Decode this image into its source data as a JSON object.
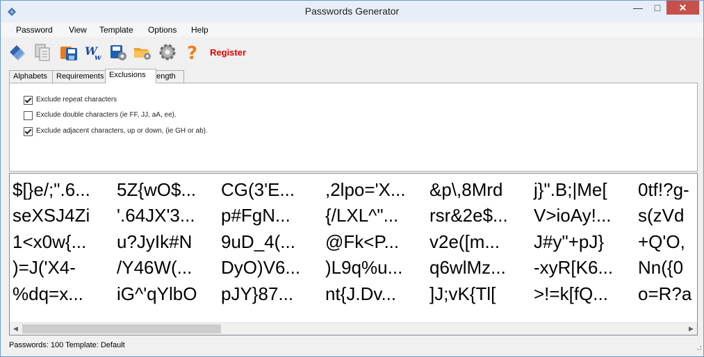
{
  "window": {
    "title": "Passwords Generator",
    "controls": [
      "—",
      "□",
      "✕"
    ]
  },
  "menu": [
    "Password",
    "View",
    "Template",
    "Options",
    "Help"
  ],
  "toolbar": {
    "icons": [
      "generate-icon",
      "copy-icon",
      "save-icon",
      "word-icon",
      "settings-save-icon",
      "folder-settings-icon",
      "gear-icon",
      "help-icon"
    ],
    "register_label": "Register"
  },
  "tabs": [
    {
      "label": "Alphabets",
      "active": false
    },
    {
      "label": "Requirements",
      "active": false
    },
    {
      "label": "Exclusions",
      "active": true
    },
    {
      "label": "Length",
      "active": false
    }
  ],
  "exclusions": [
    {
      "label": "Exclude repeat characters",
      "checked": true
    },
    {
      "label": "Exclude double characters (ie FF, JJ, aA, ee).",
      "checked": false
    },
    {
      "label": "Exclude adjacent characters, up or down, (ie GH or ab).",
      "checked": true
    }
  ],
  "passwords": [
    [
      "$[}e/;\".6...",
      "5Z{wO$...",
      "CG(3'E...",
      ",2lpo='X...",
      "&p\\,8Mrd",
      "j}\".B;|Me[",
      "0tf!?g-"
    ],
    [
      "seXSJ4Zi",
      "'.64JX'3...",
      "p#FgN...",
      "{/LXL^\"...",
      "rsr&2e$...",
      "V>ioAy!...",
      "s(zVd"
    ],
    [
      "1<x0w{...",
      "u?JyIk#N",
      "9uD_4(...",
      "@Fk<P...",
      "v2e([m...",
      "J#y\"+pJ}",
      "+Q'O,"
    ],
    [
      ")=J('X4-",
      "/Y46W(...",
      "DyO)V6...",
      ")L9q%u...",
      "q6wlMz...",
      "-xyR[K6...",
      "Nn({0"
    ],
    [
      "%dq=x...",
      "iG^'qYlbO",
      "pJY}87...",
      "nt{J.Dv...",
      "]J;vK{Tl[",
      ">!=k[fQ...",
      "o=R?a"
    ]
  ],
  "status": {
    "text": "Passwords: 100  Template: Default"
  },
  "scrollbar": {
    "left_arrow": "◀",
    "right_arrow": "▶"
  }
}
